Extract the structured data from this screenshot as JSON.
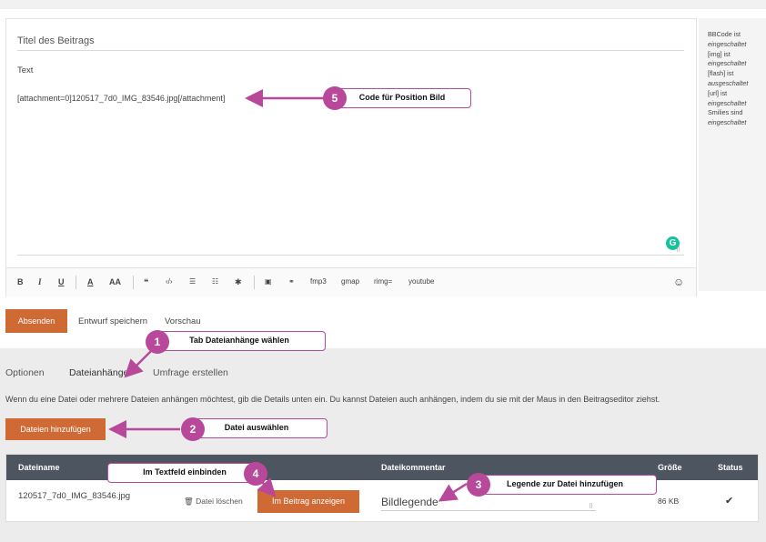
{
  "editor": {
    "title_value": "Titel des Beitrags",
    "text_label": "Text",
    "content_code": "[attachment=0]120517_7d0_IMG_83546.jpg[/attachment]"
  },
  "toolbar": {
    "bold": "B",
    "italic": "I",
    "underline": "U",
    "color": "A",
    "size": "AA",
    "quote": "❝",
    "code": "‹/›",
    "list": "☰",
    "list_numbered": "☷",
    "list_item": "✱",
    "image": "▣",
    "link": "⚭",
    "fmp3": "fmp3",
    "gmap": "gmap",
    "rimg": "rimg=",
    "youtube": "youtube",
    "smilies": "☺"
  },
  "sidebar": {
    "bbcode_label": "BBCode ist",
    "bbcode_state": "eingeschaltet",
    "img_label": "[img] ist",
    "img_state": "eingeschaltet",
    "flash_label": "[flash] ist",
    "flash_state": "ausgeschaltet",
    "url_label": "[url] ist",
    "url_state": "eingeschaltet",
    "smilies_label": "Smilies sind",
    "smilies_state": "eingeschaltet"
  },
  "actions": {
    "submit": "Absenden",
    "save_draft": "Entwurf speichern",
    "preview": "Vorschau"
  },
  "tabs": [
    "Optionen",
    "Dateianhänge",
    "Umfrage erstellen"
  ],
  "attachments": {
    "info": "Wenn du eine Datei oder mehrere Dateien anhängen möchtest, gib die Details unten ein. Du kannst Dateien auch anhängen, indem du sie mit der Maus in den Beitragseditor ziehst.",
    "add_button": "Dateien hinzufügen",
    "columns": {
      "filename": "Dateiname",
      "comment": "Dateikommentar",
      "size": "Größe",
      "status": "Status"
    },
    "row": {
      "filename": "120517_7d0_IMG_83546.jpg",
      "delete": "Datei löschen",
      "insert": "Im Beitrag anzeigen",
      "comment": "Bildlegende",
      "size": "86 KB"
    }
  },
  "annotations": {
    "n1": "1",
    "t1": "Tab Dateianhänge wählen",
    "n2": "2",
    "t2": "Datei auswählen",
    "n3": "3",
    "t3": "Legende zur Datei hinzufügen",
    "n4": "4",
    "t4": "Im Textfeld einbinden",
    "n5": "5",
    "t5": "Code für Position Bild",
    "color": "#b8489a"
  },
  "colors": {
    "accent_button": "#d06a35",
    "table_header": "#4c5560",
    "grammarly": "#15c39a"
  }
}
